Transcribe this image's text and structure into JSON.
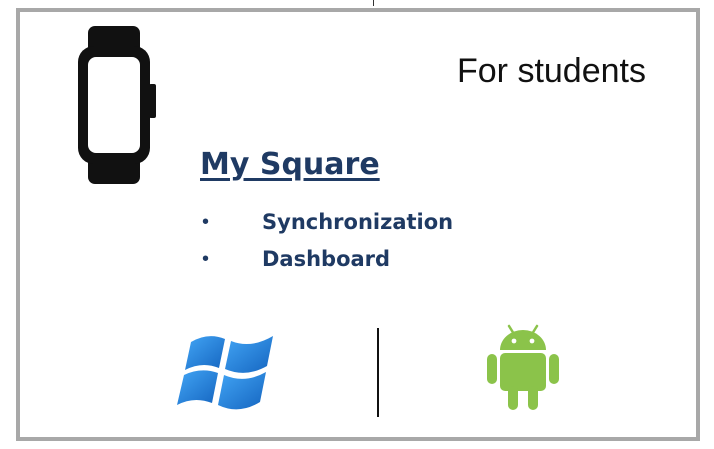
{
  "heading": "For students",
  "app_name": "My Square",
  "features": [
    {
      "bullet": "•",
      "label": "Synchronization"
    },
    {
      "bullet": "•",
      "label": "Dashboard"
    }
  ],
  "icons": {
    "device": "smartwatch-icon",
    "platform_left": "windows-logo-icon",
    "platform_right": "android-logo-icon"
  },
  "colors": {
    "title": "#1f3a63",
    "windows": "#1e88e5",
    "android": "#8bc34a",
    "frame": "#a8a8a8"
  }
}
